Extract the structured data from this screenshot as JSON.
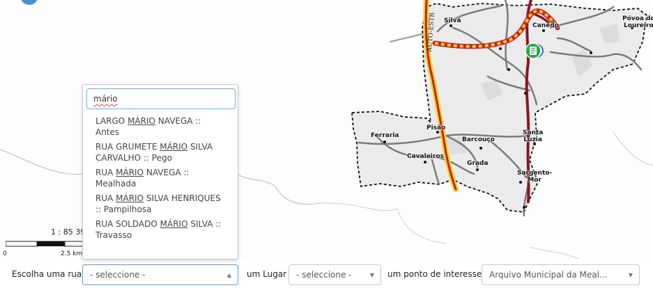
{
  "map": {
    "places": {
      "silva": "Silvã",
      "canedo": "Canedo",
      "povoa": "Póvoa do",
      "loureiro": "Loureiro",
      "ferraria": "Ferraria",
      "pisao": "Pisão",
      "barcouco": "Barcouço",
      "santa": "Santa",
      "luzia": "Luzia",
      "cavaleiros": "Cavaleiros",
      "grada": "Grada",
      "sargento": "Sargento-",
      "mor": "Mor"
    },
    "road_label": "AUTO-ESTR",
    "scale_ratio": "1 : 85 39",
    "scale_zero": "0",
    "scale_km": "2.5 km",
    "poi_icon": "document-marker-icon",
    "colors": {
      "motorway": "#c8202a",
      "motorway_casing": "#f2d322",
      "boundary": "#222222",
      "land": "#ebebeb"
    }
  },
  "dropdown": {
    "search_value": "mário",
    "results": [
      {
        "before": "LARGO ",
        "match": "MÁRIO",
        "after": " NAVEGA :: Antes"
      },
      {
        "before": "RUA GRUMETE ",
        "match": "MÁRIO",
        "after": " SILVA CARVALHO :: Pego"
      },
      {
        "before": "RUA ",
        "match": "MÁRIO",
        "after": " NAVEGA :: Mealhada"
      },
      {
        "before": "RUA ",
        "match": "MÁRIO",
        "after": " SILVA HENRIQUES :: Pampilhosa"
      },
      {
        "before": "RUA SOLDADO ",
        "match": "MÁRIO",
        "after": " SILVA :: Travasso"
      }
    ]
  },
  "filters": {
    "street_label": "Escolha uma rua",
    "street_value": "- seleccione -",
    "place_label": "um Lugar",
    "place_value": "- seleccione -",
    "poi_label": "um ponto de interesse",
    "poi_value": "Arquivo Municipal da Meal..."
  }
}
